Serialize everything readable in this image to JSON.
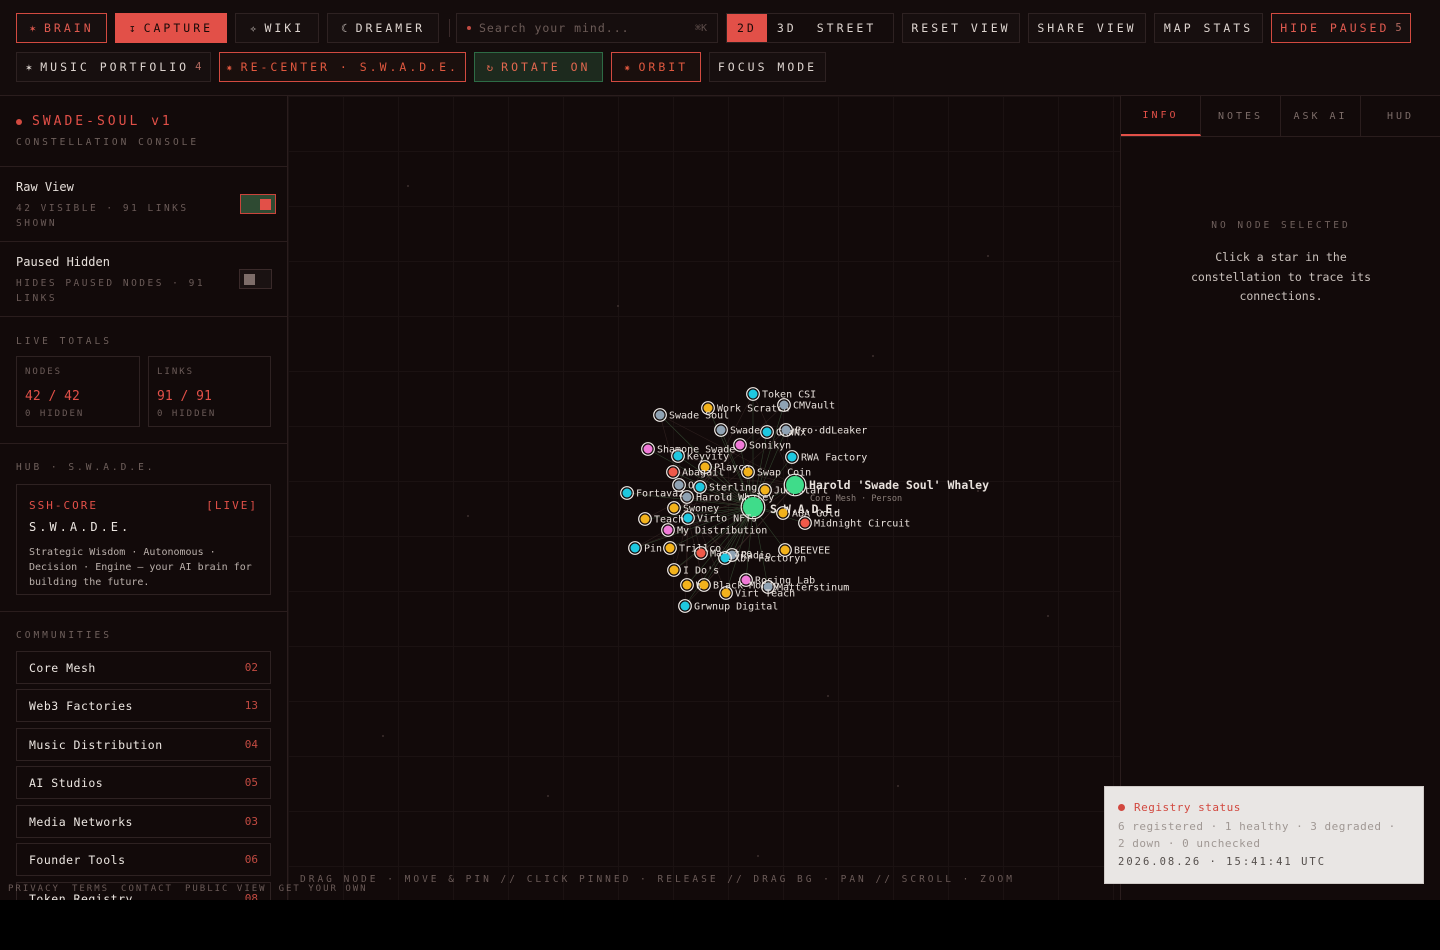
{
  "toolbar": {
    "row1": {
      "brain": {
        "glyph": "✶",
        "label": "BRAIN"
      },
      "capture": {
        "glyph": "↧",
        "label": "CAPTURE"
      },
      "wiki": {
        "glyph": "✧",
        "label": "WIKI"
      },
      "dreamer": {
        "glyph": "☾",
        "label": "DREAMER"
      },
      "search": {
        "placeholder": "Search your mind...",
        "shortcut": "⌘K"
      },
      "view_modes": [
        "2D",
        "3D",
        "STREET"
      ],
      "reset_view": "RESET VIEW",
      "share_view": "SHARE VIEW",
      "map_stats": "MAP STATS",
      "hide_paused": {
        "label": "HIDE PAUSED",
        "count": "5"
      }
    },
    "row2": {
      "music_portfolio": {
        "glyph": "✶",
        "label": "MUSIC PORTFOLIO",
        "count": "4"
      },
      "recenter": {
        "glyph": "✷",
        "label": "RE-CENTER · S.W.A.D.E."
      },
      "rotate": {
        "glyph": "↻",
        "label": "ROTATE ON"
      },
      "orbit": {
        "glyph": "✷",
        "label": "ORBIT"
      },
      "focus_mode": "FOCUS MODE"
    }
  },
  "sidebar": {
    "brand": "SWADE-SOUL v1",
    "subtitle": "CONSTELLATION CONSOLE",
    "raw_view": {
      "title": "Raw View",
      "sub": "42 VISIBLE · 91 LINKS SHOWN",
      "on": true
    },
    "paused_hidden": {
      "title": "Paused Hidden",
      "sub": "HIDES PAUSED NODES · 91 LINKS",
      "on": false
    },
    "live_totals": {
      "label": "LIVE TOTALS",
      "nodes": {
        "label": "NODES",
        "value": "42 / 42",
        "hidden": "0 HIDDEN"
      },
      "links": {
        "label": "LINKS",
        "value": "91 / 91",
        "hidden": "0 HIDDEN"
      }
    },
    "hub": {
      "label": "HUB · S.W.A.D.E.",
      "core": "SSH-CORE",
      "status": "[LIVE]",
      "title": "S.W.A.D.E.",
      "desc": "Strategic Wisdom · Autonomous · Decision · Engine — your AI brain for building the future."
    },
    "communities_label": "COMMUNITIES",
    "communities": [
      {
        "name": "Core Mesh",
        "count": "02"
      },
      {
        "name": "Web3 Factories",
        "count": "13"
      },
      {
        "name": "Music Distribution",
        "count": "04"
      },
      {
        "name": "AI Studios",
        "count": "05"
      },
      {
        "name": "Media Networks",
        "count": "03"
      },
      {
        "name": "Founder Tools",
        "count": "06"
      },
      {
        "name": "Token Registry",
        "count": "08"
      }
    ]
  },
  "canvas": {
    "hint": "DRAG NODE · MOVE & PIN // CLICK PINNED · RELEASE // DRAG BG · PAN // SCROLL · ZOOM",
    "colors": {
      "cyan": "#1ec8e0",
      "yellow": "#f2b21c",
      "grey": "#8fa2b3",
      "pink": "#f07ad8",
      "red": "#f05a4a",
      "green": "#3fdc8a",
      "violet": "#b27cf0"
    },
    "nodes": [
      {
        "label": "Token CSI",
        "color": "cyan"
      },
      {
        "label": "Work Scratch",
        "color": "yellow"
      },
      {
        "label": "CMVault",
        "color": "grey"
      },
      {
        "label": "Swade Soul",
        "color": "grey"
      },
      {
        "label": "Swade",
        "color": "grey"
      },
      {
        "label": "GRWNx",
        "color": "cyan"
      },
      {
        "label": "Pro·ddLeaker",
        "color": "grey"
      },
      {
        "label": "Shamone Swade",
        "color": "pink"
      },
      {
        "label": "Sonikyn",
        "color": "pink"
      },
      {
        "label": "Keyvity",
        "color": "cyan"
      },
      {
        "label": "RWA Factory",
        "color": "cyan"
      },
      {
        "label": "Playco",
        "color": "yellow"
      },
      {
        "label": "Abagail",
        "color": "red"
      },
      {
        "label": "Swap Coin",
        "color": "yellow"
      },
      {
        "label": "Fortavaz",
        "color": "cyan"
      },
      {
        "label": "O",
        "color": "grey"
      },
      {
        "label": "Sterling",
        "color": "cyan"
      },
      {
        "label": "Jumpstart",
        "color": "yellow"
      },
      {
        "label": "Harold 'Swade Soul' Whaley",
        "color": "green",
        "sub": "Core Mesh · Person"
      },
      {
        "label": "Harold Whaley",
        "color": "grey"
      },
      {
        "label": "S.W.A.D.E.",
        "color": "green"
      },
      {
        "label": "Swoney",
        "color": "yellow"
      },
      {
        "label": "ABA Gold",
        "color": "yellow"
      },
      {
        "label": "Teach",
        "color": "yellow"
      },
      {
        "label": "Virto NFTs",
        "color": "cyan"
      },
      {
        "label": "Midnight Circuit",
        "color": "red"
      },
      {
        "label": "My Distribution",
        "color": "pink"
      },
      {
        "label": "Pin",
        "color": "cyan"
      },
      {
        "label": "Trillco",
        "color": "yellow"
      },
      {
        "label": "Maestro",
        "color": "red"
      },
      {
        "label": "Radio",
        "color": "grey"
      },
      {
        "label": "BEEVEE",
        "color": "yellow"
      },
      {
        "label": "Xbr Factoryn",
        "color": "cyan"
      },
      {
        "label": "I Do's",
        "color": "yellow"
      },
      {
        "label": "Rosing Lab",
        "color": "pink"
      },
      {
        "label": "Wt",
        "color": "yellow"
      },
      {
        "label": "Black Money",
        "color": "yellow"
      },
      {
        "label": "Matterstinum",
        "color": "grey"
      },
      {
        "label": "Virt Teach",
        "color": "yellow"
      },
      {
        "label": "Grwnup Digital",
        "color": "cyan"
      }
    ]
  },
  "inspector": {
    "tabs": [
      "INFO",
      "NOTES",
      "ASK AI",
      "HUD"
    ],
    "active_tab": "INFO",
    "empty_title": "NO NODE SELECTED",
    "empty_msg": "Click a star in the constellation to trace its connections."
  },
  "footer": [
    "PRIVACY",
    "TERMS",
    "CONTACT",
    "PUBLIC VIEW",
    "GET YOUR OWN"
  ],
  "registry": {
    "title": "Registry status",
    "detail": "6 registered · 1 healthy · 3 degraded · 2 down · 0 unchecked",
    "timestamp": "2026.08.26 · 15:41:41 UTC"
  }
}
